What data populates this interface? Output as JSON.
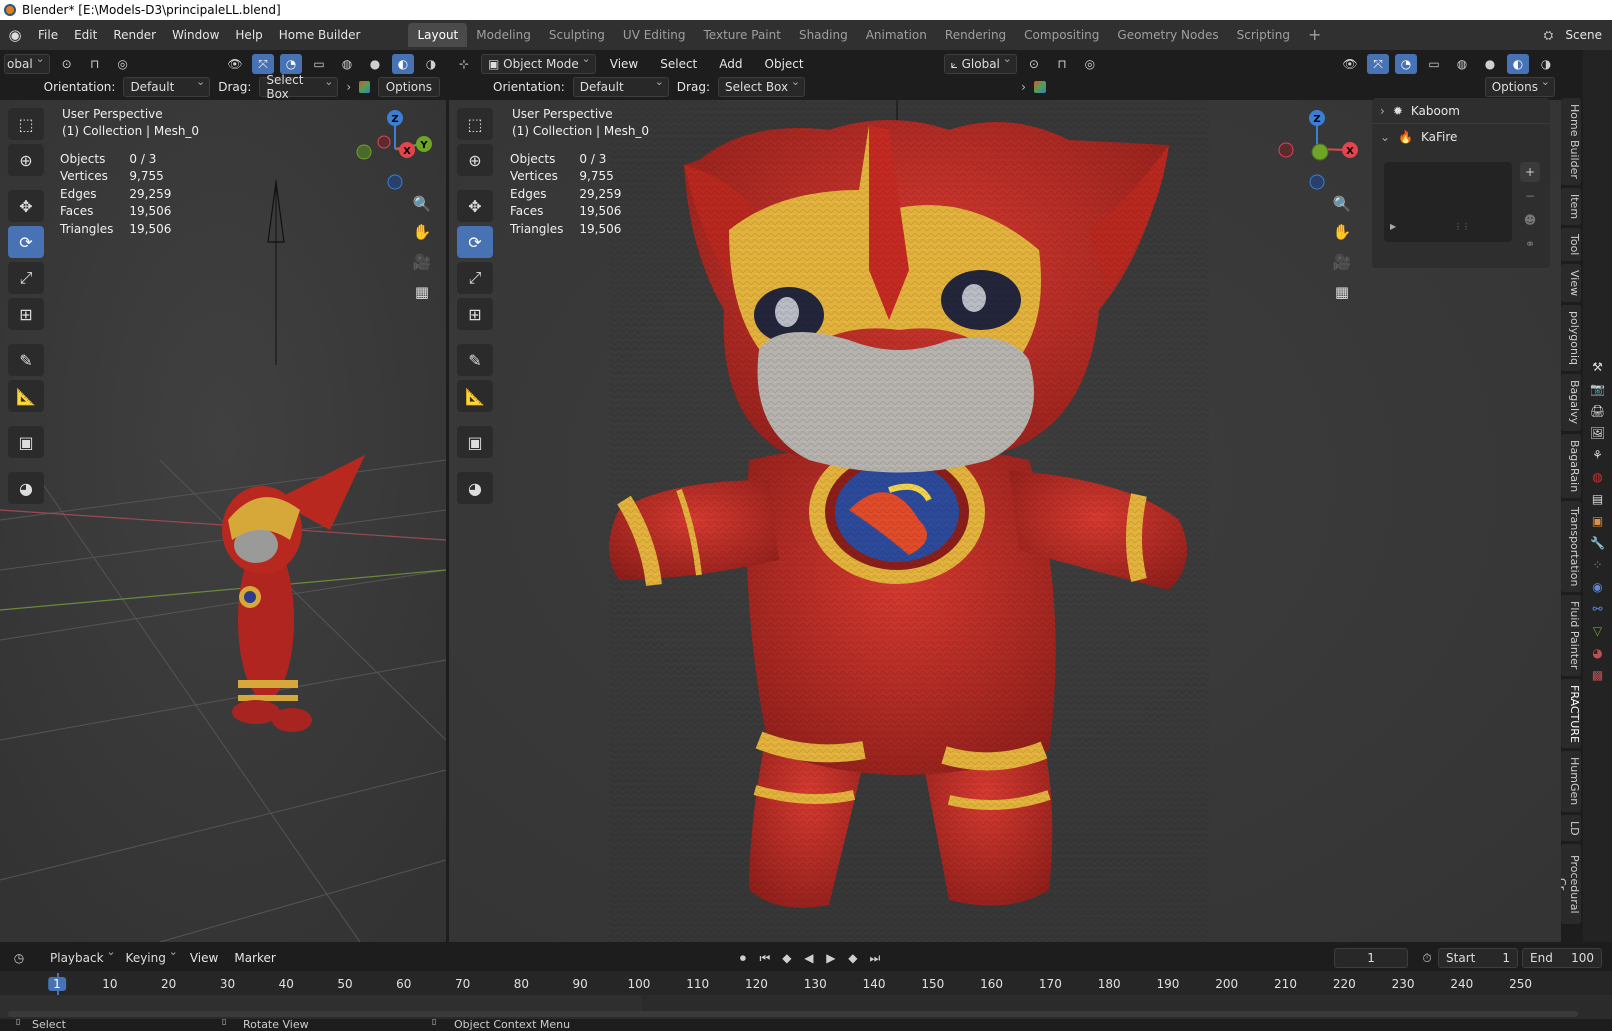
{
  "window": {
    "title": "Blender* [E:\\Models-D3\\principaleLL.blend]"
  },
  "menu": {
    "items": [
      "File",
      "Edit",
      "Render",
      "Window",
      "Help",
      "Home Builder"
    ]
  },
  "workspaces": [
    "Layout",
    "Modeling",
    "Sculpting",
    "UV Editing",
    "Texture Paint",
    "Shading",
    "Animation",
    "Rendering",
    "Compositing",
    "Geometry Nodes",
    "Scripting"
  ],
  "scene_label": "Scene",
  "left_view": {
    "transform_orientation": "obal",
    "orientation_label": "Orientation:",
    "orientation_value": "Default",
    "drag_label": "Drag:",
    "drag_value": "Select Box",
    "options_label": "Options",
    "perspective": "User Perspective",
    "collection": "(1) Collection | Mesh_0"
  },
  "main_view": {
    "mode": "Object Mode",
    "view": "View",
    "select": "Select",
    "add": "Add",
    "object": "Object",
    "transform_orientation": "Global",
    "orientation_label": "Orientation:",
    "orientation_value": "Default",
    "drag_label": "Drag:",
    "drag_value": "Select Box",
    "options_label": "Options",
    "perspective": "User Perspective",
    "collection": "(1) Collection | Mesh_0"
  },
  "stats": {
    "labels": [
      "Objects",
      "Vertices",
      "Edges",
      "Faces",
      "Triangles"
    ],
    "values": [
      "0 / 3",
      "9,755",
      "29,259",
      "19,506",
      "19,506"
    ]
  },
  "gizmo": {
    "x": "X",
    "y": "Y",
    "z": "Z"
  },
  "side_panel": {
    "items": [
      "Kaboom",
      "KaFire"
    ]
  },
  "vertical_tabs": [
    "Home Builder",
    "Item",
    "Tool",
    "View",
    "polygoniq",
    "Bagalvy",
    "BagaRain",
    "Transportation",
    "Fluid Painter",
    "FRACTURE",
    "HumGen",
    "LD",
    "Procedural Cr"
  ],
  "timeline": {
    "playback": "Playback",
    "keying": "Keying",
    "view": "View",
    "marker": "Marker",
    "current_frame": "1",
    "start_label": "Start",
    "start_value": "1",
    "end_label": "End",
    "end_value": "100",
    "ruler": [
      "1",
      "10",
      "20",
      "30",
      "40",
      "50",
      "60",
      "70",
      "80",
      "90",
      "100",
      "110",
      "120",
      "130",
      "140",
      "150",
      "160",
      "170",
      "180",
      "190",
      "200",
      "210",
      "220",
      "230",
      "240",
      "250"
    ]
  },
  "status": {
    "select": "Select",
    "rotate": "Rotate View",
    "context": "Object Context Menu"
  },
  "colors": {
    "accent": "#4772b3",
    "x_axis": "#e2454c",
    "y_axis": "#6fa527",
    "z_axis": "#3a7fd5",
    "doll_red": "#c62a24",
    "doll_yellow": "#e2b23c"
  }
}
